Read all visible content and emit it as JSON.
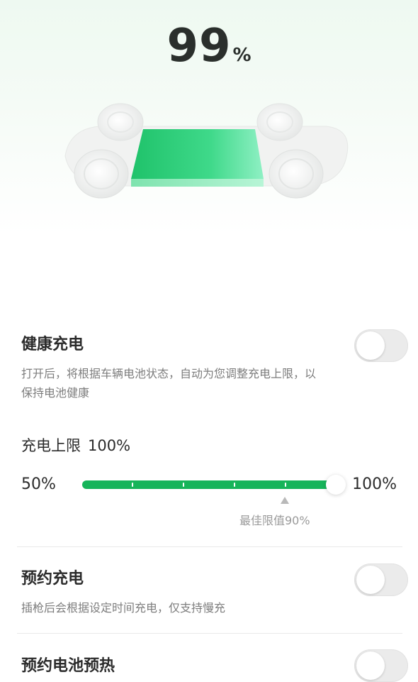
{
  "battery": {
    "level": "99",
    "unit": "%"
  },
  "healthy_charging": {
    "title": "健康充电",
    "description": "打开后，将根据车辆电池状态，自动为您调整充电上限，以保持电池健康",
    "enabled": false
  },
  "charge_limit": {
    "label": "充电上限",
    "value_text": "100%",
    "min_label": "50%",
    "max_label": "100%",
    "value_percent": 100,
    "best_note": "最佳限值90%",
    "best_percent": 90
  },
  "scheduled_charging": {
    "title": "预约充电",
    "description": "插枪后会根据设定时间充电，仅支持慢充",
    "enabled": false
  },
  "battery_preheat": {
    "title": "预约电池预热",
    "enabled": false
  },
  "colors": {
    "accent": "#16b45a",
    "battery_top": "#2ecf7b",
    "battery_light": "#8ff0c4"
  }
}
